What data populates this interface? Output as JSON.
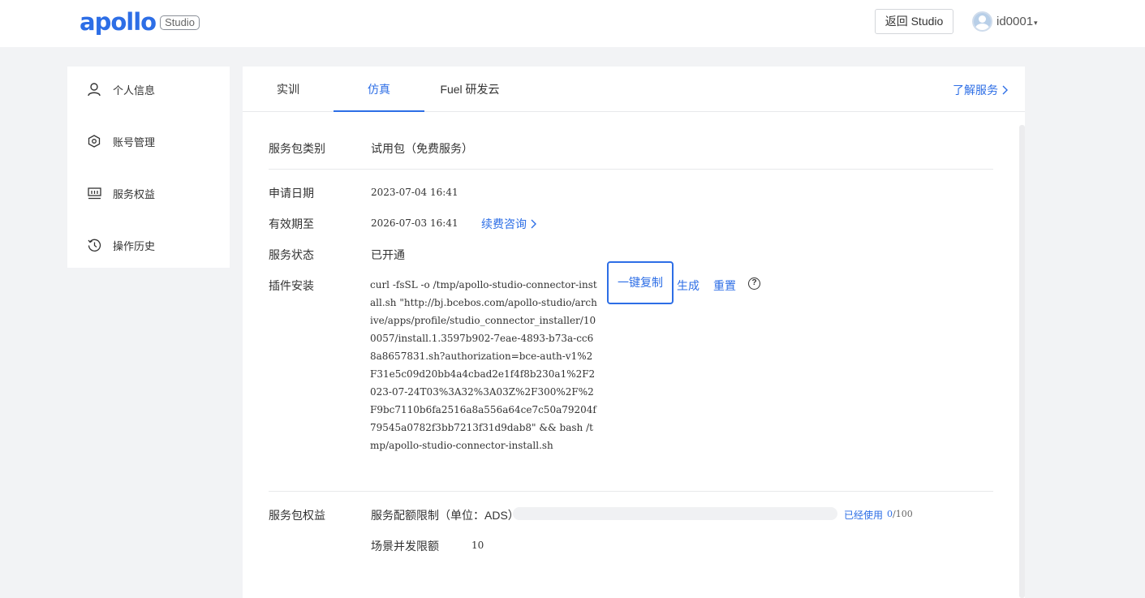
{
  "header": {
    "logo_text": "apollo",
    "logo_badge": "Studio",
    "back_button": "返回 Studio",
    "user_name": "id0001",
    "user_caret": "▾"
  },
  "sidebar": {
    "items": [
      {
        "label": "个人信息",
        "icon": "user-icon"
      },
      {
        "label": "账号管理",
        "icon": "settings-icon"
      },
      {
        "label": "服务权益",
        "icon": "benefits-icon"
      },
      {
        "label": "操作历史",
        "icon": "history-icon"
      }
    ]
  },
  "tabs": {
    "items": [
      {
        "label": "实训",
        "active": false
      },
      {
        "label": "仿真",
        "active": true
      },
      {
        "label": "Fuel 研发云",
        "active": false
      }
    ],
    "learn_more": "了解服务"
  },
  "details": {
    "package_type_label": "服务包类别",
    "package_type_value": "试用包（免费服务）",
    "apply_date_label": "申请日期",
    "apply_date_value": "2023-07-04 16:41",
    "valid_until_label": "有效期至",
    "valid_until_value": "2026-07-03 16:41",
    "renew_link": "续费咨询",
    "status_label": "服务状态",
    "status_value": "已开通",
    "plugin_label": "插件安装",
    "plugin_command": "curl -fsSL -o /tmp/apollo-studio-connector-install.sh \"http://bj.bcebos.com/apollo-studio/archive/apps/profile/studio_connector_installer/100057/install.1.3597b902-7eae-4893-b73a-cc68a8657831.sh?authorization=bce-auth-v1%2F31e5c09d20bb4a4cbad2e1f4f8b230a1%2F2023-07-24T03%3A32%3A03Z%2F300%2F%2F9bc7110b6fa2516a8a556a64ce7c50a79204f79545a0782f3bb7213f31d9dab8\" && bash /tmp/apollo-studio-connector-install.sh",
    "copy_button": "一键复制",
    "generate_button": "生成",
    "reset_button": "重置",
    "help_icon": "?"
  },
  "benefits": {
    "label": "服务包权益",
    "quota_label": "服务配额限制（单位：ADS）",
    "quota_used_label": "已经使用",
    "quota_used": "0",
    "quota_total": "/100",
    "quota_fraction": 0,
    "concurrency_label": "场景并发限额",
    "concurrency_value": "10"
  },
  "colors": {
    "accent": "#2d6ee6",
    "background": "#f2f3f5"
  }
}
